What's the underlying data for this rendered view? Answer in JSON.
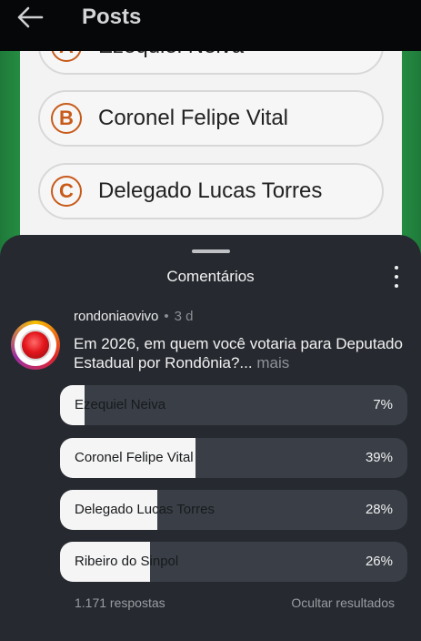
{
  "header": {
    "title": "Posts"
  },
  "post_image": {
    "options": [
      {
        "letter": "A",
        "name": "Ezequiel Neiva"
      },
      {
        "letter": "B",
        "name": "Coronel Felipe Vital"
      },
      {
        "letter": "C",
        "name": "Delegado Lucas Torres"
      }
    ],
    "colors": {
      "green": "#2aa04a",
      "yellow": "#f0cf2a",
      "accent": "#c85a1a"
    }
  },
  "sheet": {
    "title": "Comentários"
  },
  "comment": {
    "username": "rondoniaovivo",
    "time": "3 d",
    "text": "Em 2026, em quem você votaria para Deputado Estadual por Rondônia?...",
    "more_label": "mais",
    "avatar_icon": "station-logo-icon"
  },
  "poll": {
    "options": [
      {
        "label": "Ezequiel Neiva",
        "percent": "7%",
        "fraction": 0.07
      },
      {
        "label": "Coronel Felipe Vital",
        "percent": "39%",
        "fraction": 0.39
      },
      {
        "label": "Delegado Lucas Torres",
        "percent": "28%",
        "fraction": 0.28
      },
      {
        "label": "Ribeiro do Sinpol",
        "percent": "26%",
        "fraction": 0.26
      }
    ],
    "responses": "1.171 respostas",
    "hide_results": "Ocultar resultados"
  }
}
